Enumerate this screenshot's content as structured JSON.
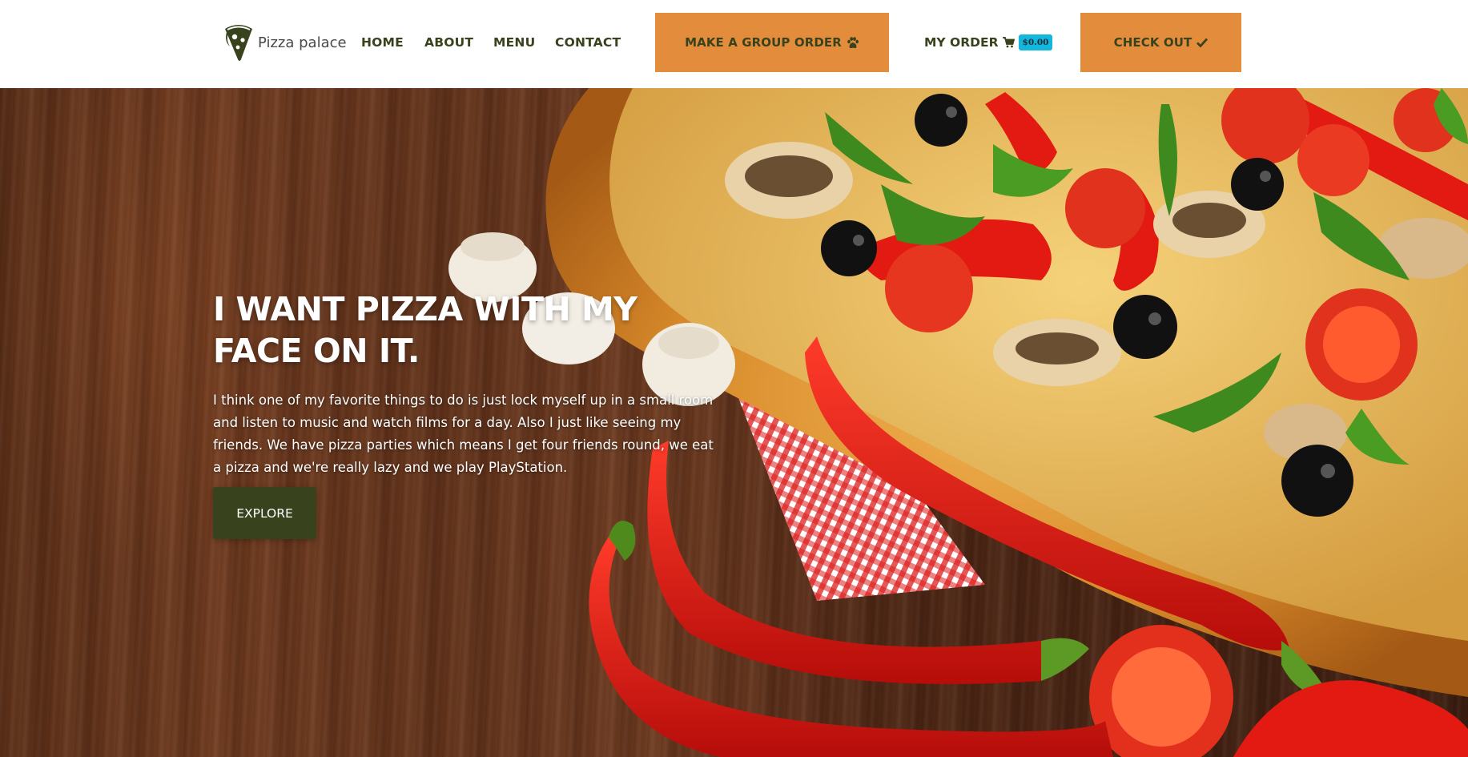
{
  "brand": {
    "name": "Pizza palace",
    "logo_icon": "pizza-slice-icon"
  },
  "nav": {
    "items": [
      {
        "label": "HOME"
      },
      {
        "label": "ABOUT"
      },
      {
        "label": "MENU"
      },
      {
        "label": "CONTACT"
      }
    ]
  },
  "group_order": {
    "label": "MAKE A GROUP ORDER",
    "icon": "paw-icon"
  },
  "my_order": {
    "label": "MY ORDER",
    "icon": "shopping-cart-icon",
    "total": "$0.00"
  },
  "checkout": {
    "label": "CHECK OUT",
    "icon": "checkmark-icon"
  },
  "hero": {
    "title": "I WANT PIZZA WITH MY FACE ON IT.",
    "text": "I think one of my favorite things to do is just lock myself up in a small room and listen to music and watch films for a day. Also I just like seeing my friends. We have pizza parties which means I get four friends round, we eat a pizza and we're really lazy and we play PlayStation.",
    "cta_label": "EXPLORE",
    "background": "pizza-on-wooden-table-photo"
  },
  "colors": {
    "accent_orange": "#e38d3c",
    "dark_olive": "#38421d",
    "badge_cyan": "#13b7dd",
    "nav_background": "#ffffff"
  }
}
